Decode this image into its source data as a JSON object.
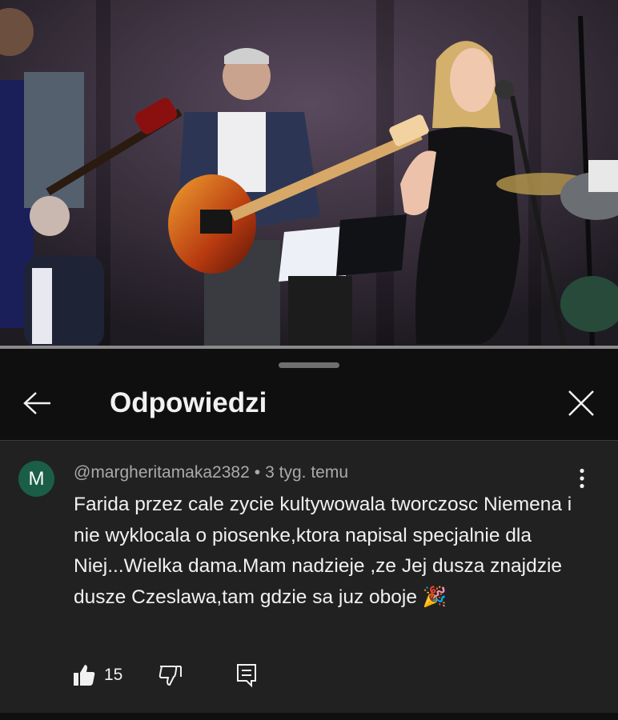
{
  "video": {
    "description_icon": "video-frame"
  },
  "panel": {
    "title": "Odpowiedzi",
    "back_icon": "arrow-left-icon",
    "close_icon": "close-icon"
  },
  "comment": {
    "avatar_letter": "M",
    "avatar_color": "#1b5e48",
    "author": "@margheritamaka2382",
    "separator": "•",
    "time": "3 tyg. temu",
    "text": "Farida przez cale zycie kultywowala tworczosc Niemena i nie wyklocala o piosenke,ktora napisal specjalnie dla Niej...Wielka dama.Mam nadzieje ,ze Jej dusza znajdzie dusze Czeslawa,tam gdzie sa juz oboje 🎉",
    "like_count": "15"
  }
}
